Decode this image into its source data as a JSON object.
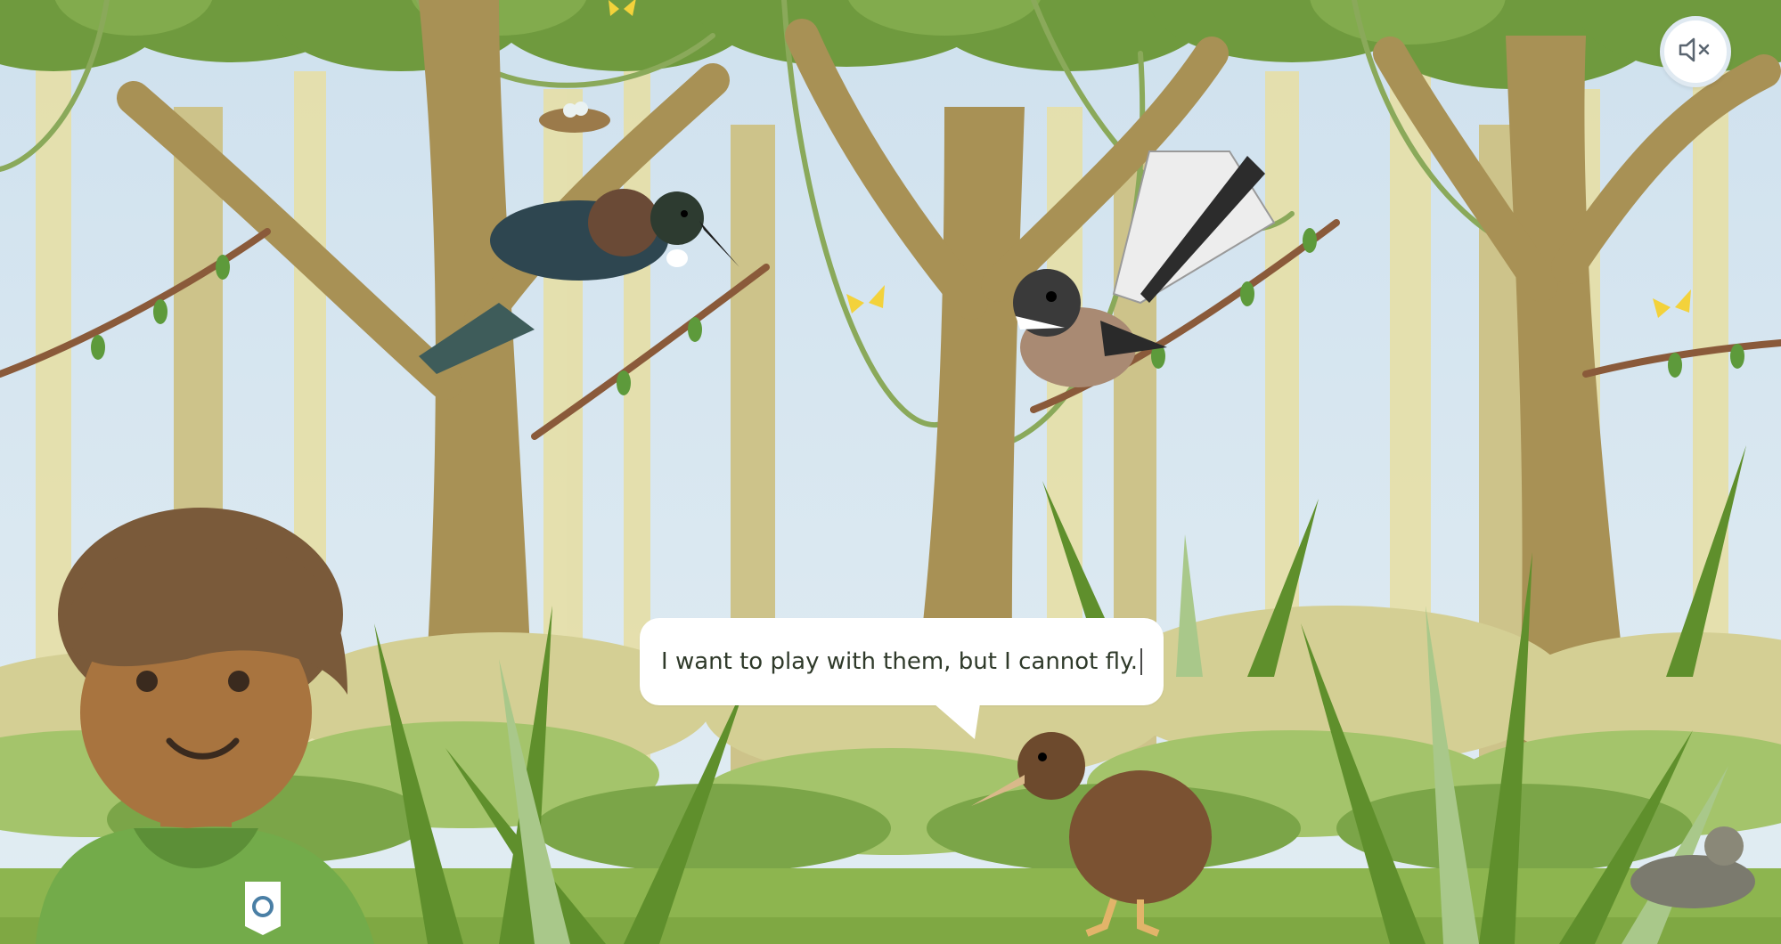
{
  "scene": {
    "dialogue": {
      "text": "I want to play with them, but I cannot fly."
    },
    "mute_button": {
      "icon": "speaker-muted-icon"
    },
    "characters": [
      "tui",
      "fantail",
      "kiwi",
      "ranger",
      "tuatara"
    ],
    "colors": {
      "sky": "#d9e8f2",
      "grass": "#8db54f",
      "bubble": "#ffffff",
      "shirt": "#73ab4a"
    }
  }
}
